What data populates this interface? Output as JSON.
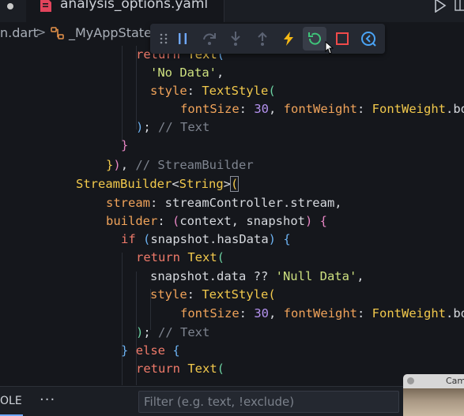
{
  "tabs": {
    "active_file": "analysis_options.yaml"
  },
  "breadcrumb": {
    "file": "n.dart",
    "separator": ">",
    "class_name": "_MyAppState"
  },
  "debug_toolbar": {
    "buttons": [
      "drag-handle",
      "pause",
      "step-over",
      "step-into",
      "step-out",
      "hot-reload",
      "hot-restart",
      "stop",
      "open-devtools"
    ]
  },
  "code": {
    "lines": [
      {
        "tokens": [
          [
            "kw",
            "return "
          ],
          [
            "cls",
            "Text"
          ],
          [
            "brk-b",
            "("
          ]
        ]
      },
      {
        "tokens": [
          [
            "str",
            "'No Data'"
          ],
          [
            "pn",
            ","
          ]
        ]
      },
      {
        "tokens": [
          [
            "prop",
            "style"
          ],
          [
            "pn",
            ": "
          ],
          [
            "cls",
            "TextStyle"
          ],
          [
            "brk-g",
            "("
          ]
        ]
      },
      {
        "tokens": [
          [
            "prop",
            "fontSize"
          ],
          [
            "pn",
            ": "
          ],
          [
            "num",
            "30"
          ],
          [
            "pn",
            ", "
          ],
          [
            "prop",
            "fontWeight"
          ],
          [
            "pn",
            ": "
          ],
          [
            "cls",
            "FontWeight"
          ],
          [
            "pn",
            ".bo"
          ]
        ]
      },
      {
        "tokens": [
          [
            "brk-b",
            ")"
          ],
          [
            "pn",
            "; "
          ],
          [
            "cmt",
            "// Text"
          ]
        ]
      },
      {
        "tokens": [
          [
            "brk-p",
            "}"
          ]
        ]
      },
      {
        "tokens": [
          [
            "brk-y",
            "}"
          ],
          [
            "brk-p",
            ")"
          ],
          [
            "pn",
            ", "
          ],
          [
            "cmt",
            "// StreamBuilder"
          ]
        ]
      },
      {
        "tokens": [
          [
            "cls",
            "StreamBuilder"
          ],
          [
            "pn",
            "<"
          ],
          [
            "cls",
            "String"
          ],
          [
            "pn",
            ">"
          ],
          [
            "brk-y",
            "("
          ]
        ]
      },
      {
        "tokens": [
          [
            "prop",
            "stream"
          ],
          [
            "pn",
            ": streamController.stream,"
          ]
        ]
      },
      {
        "tokens": [
          [
            "prop",
            "builder"
          ],
          [
            "pn",
            ": "
          ],
          [
            "brk-p",
            "("
          ],
          [
            "pn",
            "context, snapshot"
          ],
          [
            "brk-p",
            ")"
          ],
          [
            "pn",
            " "
          ],
          [
            "brk-p",
            "{"
          ]
        ]
      },
      {
        "tokens": [
          [
            "kw",
            "if "
          ],
          [
            "brk-b",
            "("
          ],
          [
            "pn",
            "snapshot.hasData"
          ],
          [
            "brk-b",
            ")"
          ],
          [
            "pn",
            " "
          ],
          [
            "brk-b",
            "{"
          ]
        ]
      },
      {
        "tokens": [
          [
            "kw",
            "return "
          ],
          [
            "cls",
            "Text"
          ],
          [
            "brk-g",
            "("
          ]
        ]
      },
      {
        "tokens": [
          [
            "pn",
            "snapshot.data ?? "
          ],
          [
            "str",
            "'Null Data'"
          ],
          [
            "pn",
            ","
          ]
        ]
      },
      {
        "tokens": [
          [
            "prop",
            "style"
          ],
          [
            "pn",
            ": "
          ],
          [
            "cls",
            "TextStyle"
          ],
          [
            "brk-y",
            "("
          ]
        ]
      },
      {
        "tokens": [
          [
            "prop",
            "fontSize"
          ],
          [
            "pn",
            ": "
          ],
          [
            "num",
            "30"
          ],
          [
            "pn",
            ", "
          ],
          [
            "prop",
            "fontWeight"
          ],
          [
            "pn",
            ": "
          ],
          [
            "cls",
            "FontWeight"
          ],
          [
            "pn",
            ".bo"
          ]
        ]
      },
      {
        "tokens": [
          [
            "brk-g",
            ")"
          ],
          [
            "pn",
            "; "
          ],
          [
            "cmt",
            "// Text"
          ]
        ]
      },
      {
        "tokens": [
          [
            "brk-b",
            "}"
          ],
          [
            "pn",
            " "
          ],
          [
            "kw",
            "else "
          ],
          [
            "brk-b",
            "{"
          ]
        ]
      },
      {
        "tokens": [
          [
            "kw",
            "return "
          ],
          [
            "cls",
            "Text"
          ],
          [
            "brk-g",
            "("
          ]
        ]
      }
    ]
  },
  "panel": {
    "tab_label": "OLE",
    "more_label": "···",
    "filter_placeholder": "Filter (e.g. text, !exclude)"
  },
  "camera": {
    "title": "Cam"
  },
  "colors": {
    "background": "#15171c",
    "keyword": "#ef7a6a",
    "class": "#f2c94c",
    "string": "#cde07f",
    "property": "#f0a35a",
    "number": "#b592f0",
    "comment": "#7e848f",
    "hot_reload": "#f5b814",
    "hot_restart": "#3fc47a",
    "stop": "#f04a4a",
    "devtools": "#4aa3f5"
  }
}
